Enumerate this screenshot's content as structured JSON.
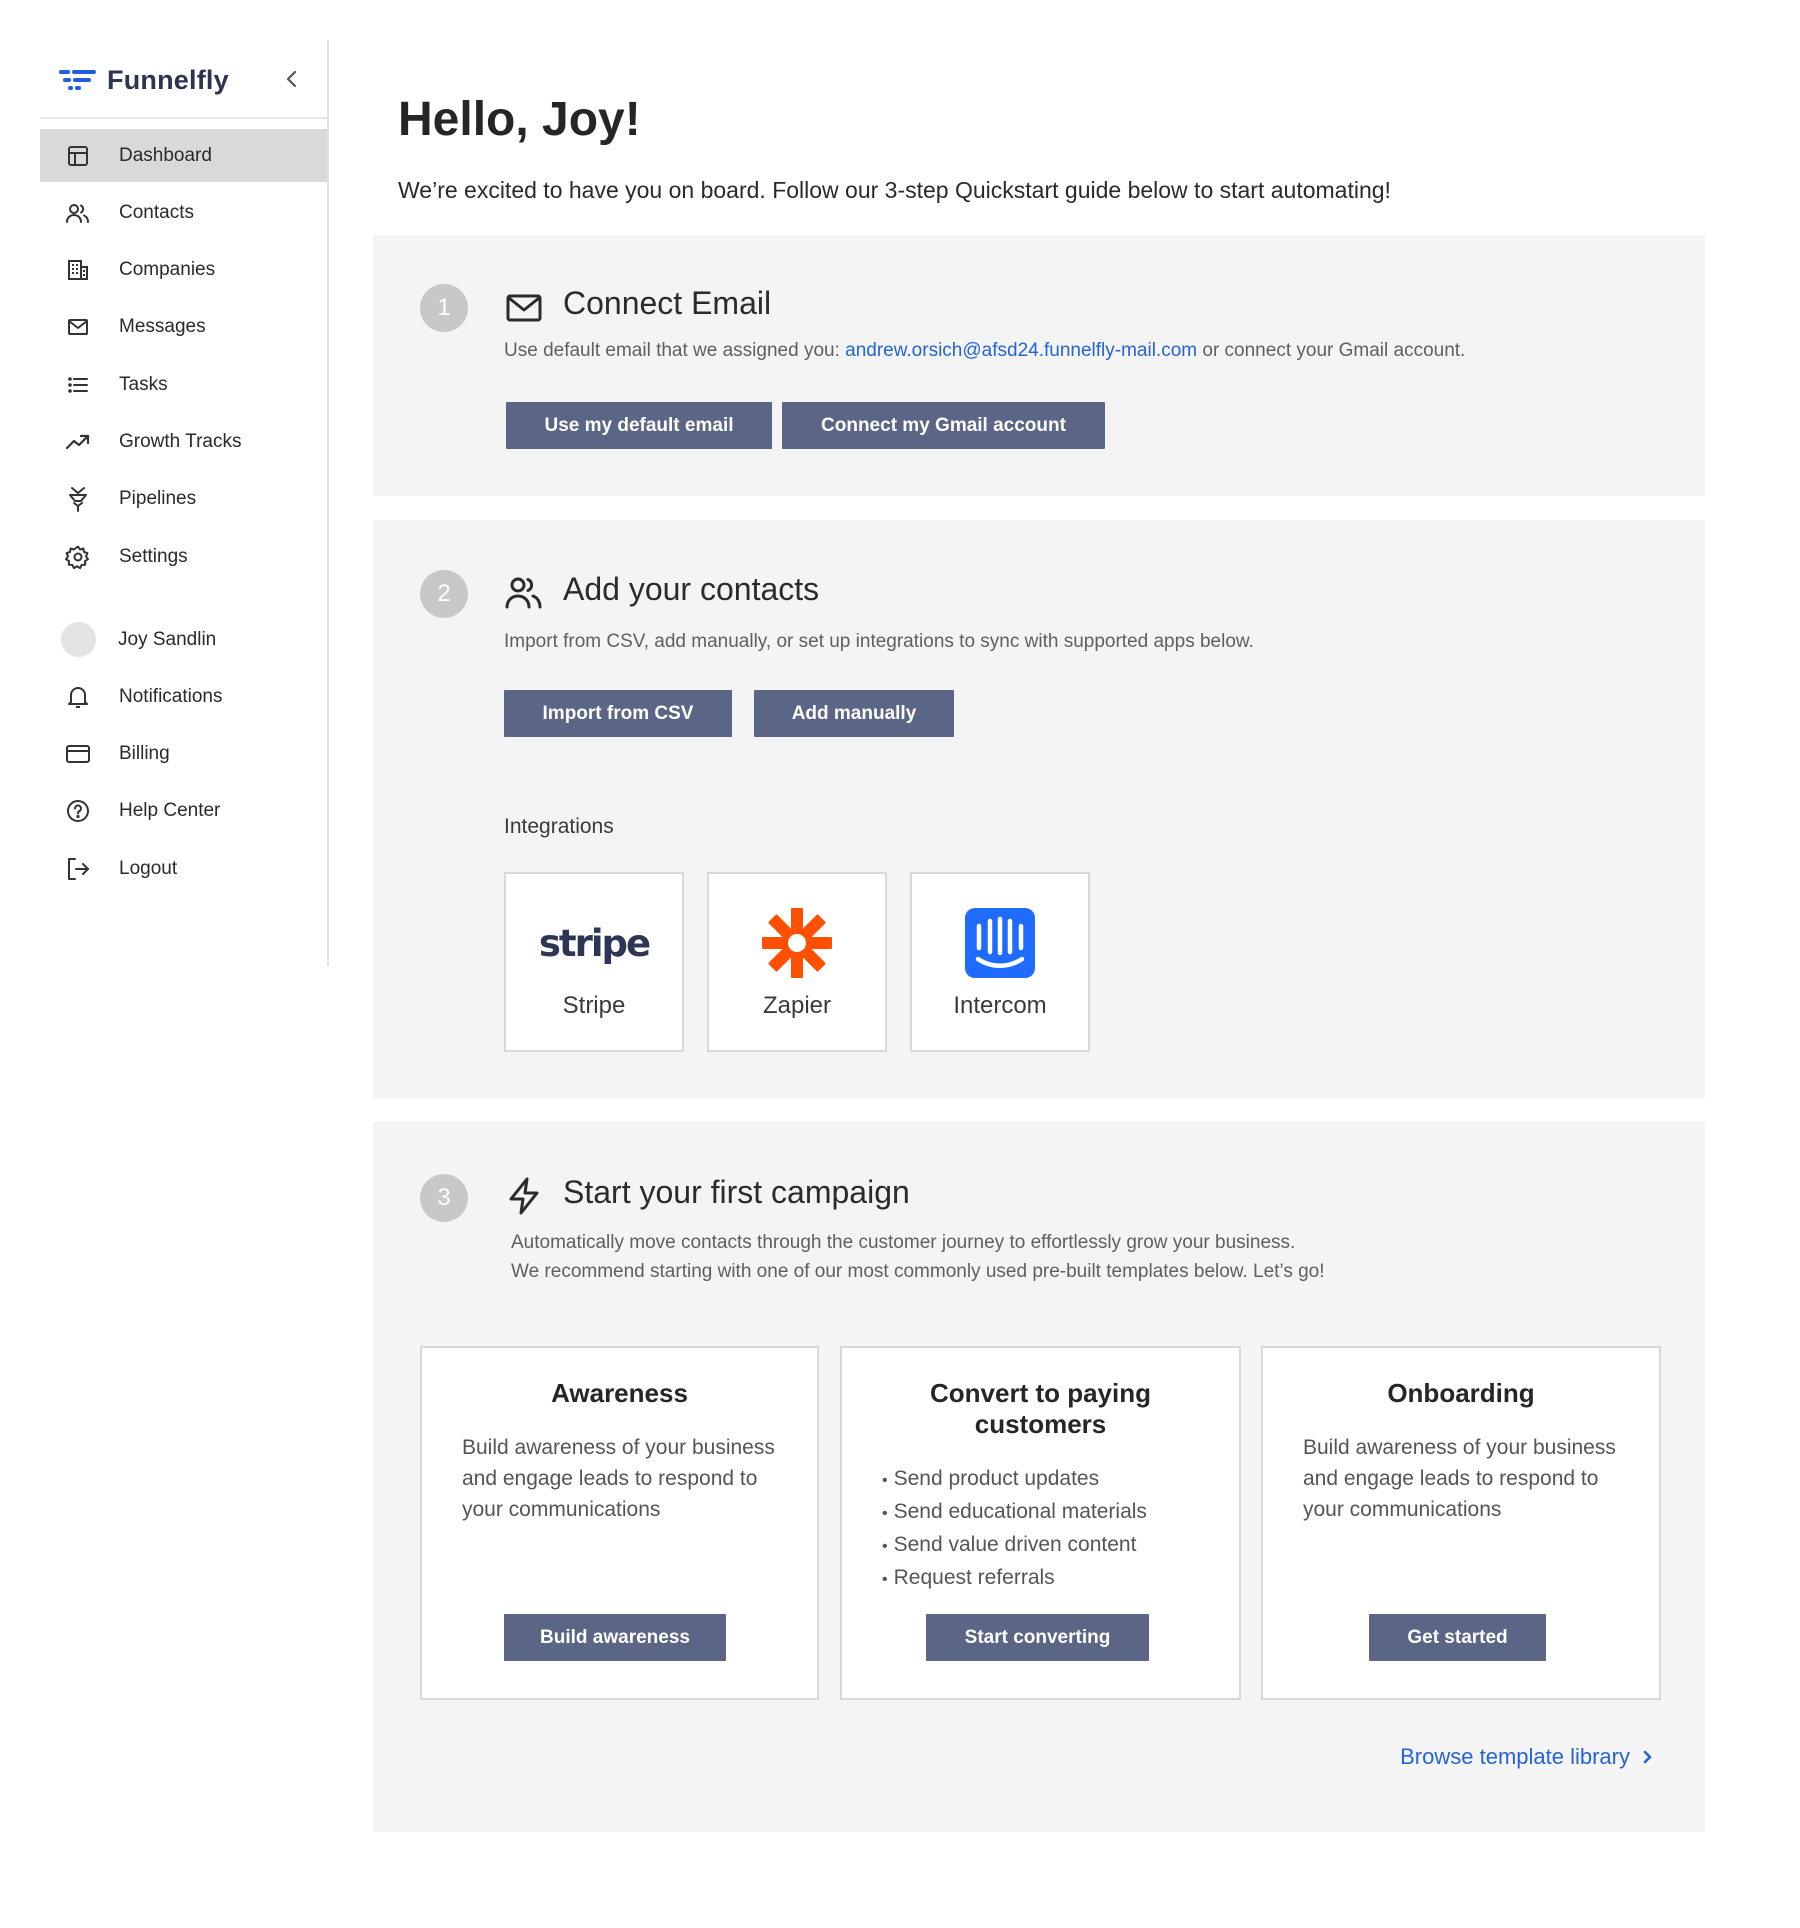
{
  "sidebar": {
    "brand": "Funnelfly",
    "items": [
      {
        "label": "Dashboard",
        "icon": "dashboard-icon"
      },
      {
        "label": "Contacts",
        "icon": "contacts-icon"
      },
      {
        "label": "Companies",
        "icon": "building-icon"
      },
      {
        "label": "Messages",
        "icon": "mail-icon"
      },
      {
        "label": "Tasks",
        "icon": "list-icon"
      },
      {
        "label": "Growth Tracks",
        "icon": "trending-up-icon"
      },
      {
        "label": "Pipelines",
        "icon": "pipeline-icon"
      },
      {
        "label": "Settings",
        "icon": "gear-icon"
      }
    ],
    "account": [
      {
        "label": "Joy Sandlin",
        "icon": "avatar"
      },
      {
        "label": "Notifications",
        "icon": "bell-icon"
      },
      {
        "label": "Billing",
        "icon": "credit-card-icon"
      },
      {
        "label": "Help Center",
        "icon": "help-circle-icon"
      },
      {
        "label": "Logout",
        "icon": "logout-icon"
      }
    ]
  },
  "main": {
    "title": "Hello, Joy!",
    "intro": "We’re excited to have you on board. Follow our 3-step Quickstart guide below to start automating!"
  },
  "steps": {
    "email": {
      "number": "1",
      "title": "Connect Email",
      "desc_before": "Use default email that we assigned you: ",
      "email": "andrew.orsich@afsd24.funnelfly-mail.com",
      "desc_after": " or connect your Gmail account.",
      "btn_default": "Use my default email",
      "btn_gmail": "Connect my Gmail account"
    },
    "contacts": {
      "number": "2",
      "title": "Add your contacts",
      "desc": "Import from CSV, add manually, or set up integrations to sync with supported apps below.",
      "btn_csv": "Import from CSV",
      "btn_manual": "Add manually",
      "integrations_label": "Integrations",
      "integrations": [
        {
          "name": "Stripe",
          "logo_text": "stripe"
        },
        {
          "name": "Zapier"
        },
        {
          "name": "Intercom"
        }
      ]
    },
    "campaign": {
      "number": "3",
      "title": "Start your first campaign",
      "desc_line1": "Automatically move contacts through the customer journey to effortlessly grow your business.",
      "desc_line2": "We recommend starting with one of our most commonly used pre-built templates below. Let’s go!",
      "templates": [
        {
          "title": "Awareness",
          "desc": "Build awareness of your business and engage leads to respond to your communications",
          "button": "Build awareness"
        },
        {
          "title": "Convert to paying customers",
          "bullets": [
            "Send product updates",
            "Send educational materials",
            "Send value driven content",
            "Request referrals"
          ],
          "button": "Start converting"
        },
        {
          "title": "Onboarding",
          "desc": "Build awareness of your business and engage leads to respond to your communications",
          "button": "Get started"
        }
      ],
      "browse_link": "Browse template library"
    }
  },
  "colors": {
    "brand": "#1f5fe0",
    "button": "#5b6585",
    "link": "#2563d8",
    "panel": "#f4f4f4",
    "active_nav": "#d9d9d9",
    "zapier": "#ff4f00",
    "intercom": "#1f6bff"
  }
}
